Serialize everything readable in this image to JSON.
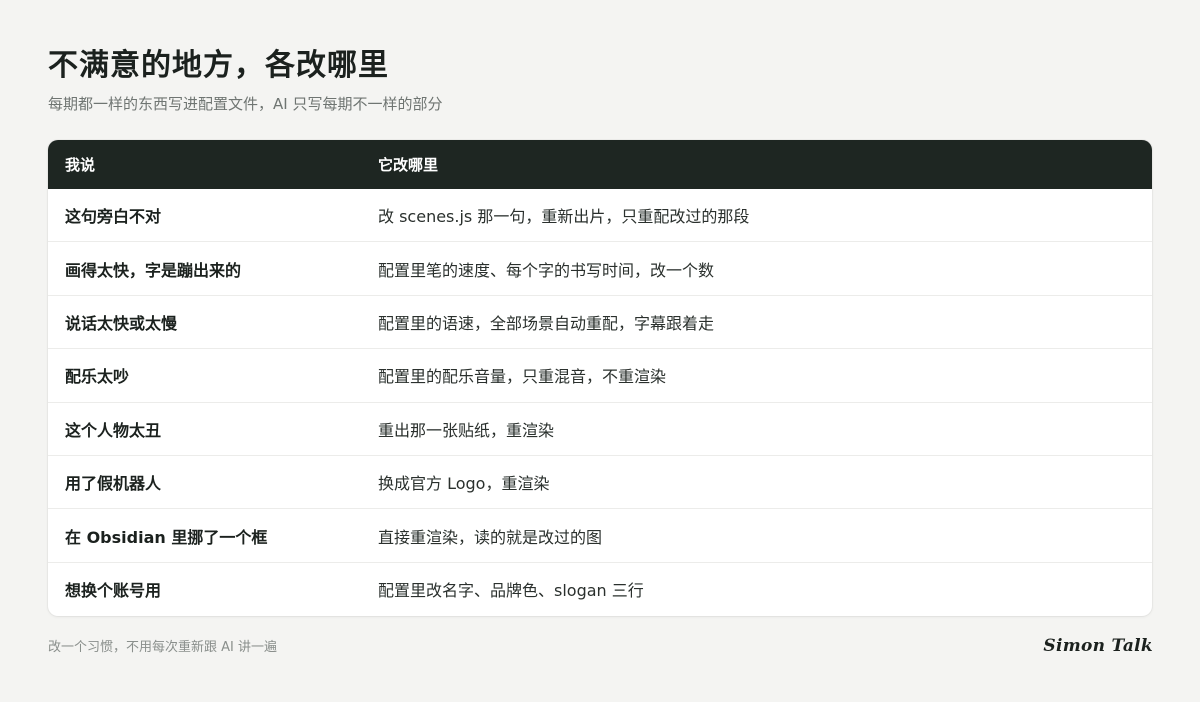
{
  "header": {
    "title": "不满意的地方，各改哪里",
    "subtitle": "每期都一样的东西写进配置文件，AI 只写每期不一样的部分"
  },
  "table": {
    "columns": [
      "我说",
      "它改哪里"
    ],
    "rows": [
      [
        "这句旁白不对",
        "改 scenes.js 那一句，重新出片，只重配改过的那段"
      ],
      [
        "画得太快，字是蹦出来的",
        "配置里笔的速度、每个字的书写时间，改一个数"
      ],
      [
        "说话太快或太慢",
        "配置里的语速，全部场景自动重配，字幕跟着走"
      ],
      [
        "配乐太吵",
        "配置里的配乐音量，只重混音，不重渲染"
      ],
      [
        "这个人物太丑",
        "重出那一张贴纸，重渲染"
      ],
      [
        "用了假机器人",
        "换成官方 Logo，重渲染"
      ],
      [
        "在 Obsidian 里挪了一个框",
        "直接重渲染，读的就是改过的图"
      ],
      [
        "想换个账号用",
        "配置里改名字、品牌色、slogan 三行"
      ]
    ]
  },
  "footer": {
    "note": "改一个习惯，不用每次重新跟 AI 讲一遍",
    "brand": "Simon Talk"
  },
  "colors": {
    "background": "#f4f4f2",
    "header_bg": "#1e2622",
    "text_primary": "#1b211e",
    "text_secondary": "#6f7572"
  }
}
